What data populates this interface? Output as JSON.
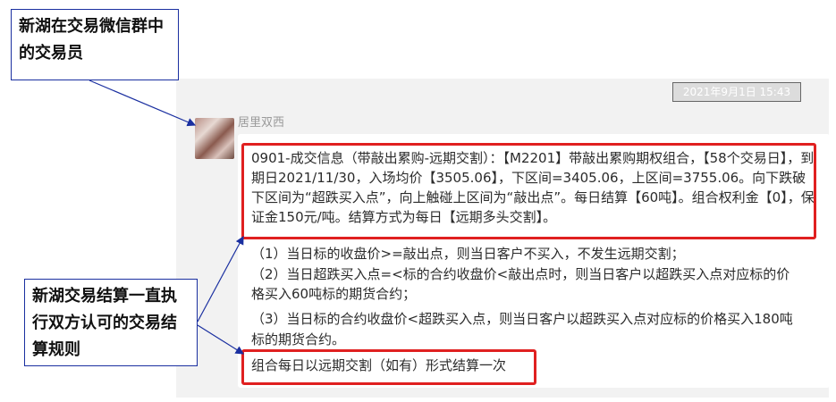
{
  "timestamp": "2021年9月1日 15:43",
  "sender": "居里双西",
  "message": {
    "main": "0901-成交信息（带敲出累购-远期交割）：【M2201】带敲出累购期权组合，【58个交易日】，到期日2021/11/30，入场均价【3505.06】，下区间=3405.06，上区间=3755.06。向下跌破下区间为“超跌买入点”，向上触碰上区间为“敲出点”。每日结算【60吨】。组合权利金【0】，保证金150元/吨。结算方式为每日【远期多头交割】。",
    "line1": "（1）当日标的收盘价>=敲出点，则当日客户不买入，不发生远期交割；",
    "line2": "（2）当日超跌买入点=<标的合约收盘价<敲出点时，则当日客户以超跌买入点对应标的价",
    "line3": "格买入60吨标的期货合约；",
    "line4": "（3）当日标的合约收盘价<超跌买入点，则当日客户以超跌买入点对应标的价格买入180吨",
    "line5": "标的期货合约。",
    "line6": "组合每日以远期交割（如有）形式结算一次"
  },
  "annotations": {
    "callout1": "新湖在交易微信群中的交易员",
    "callout2": "新湖交易结算一直执行双方认可的交易结算规则"
  },
  "colors": {
    "highlight": "#e02020",
    "callout_border": "#1a2fa0",
    "panel": "#f2f2f2"
  }
}
